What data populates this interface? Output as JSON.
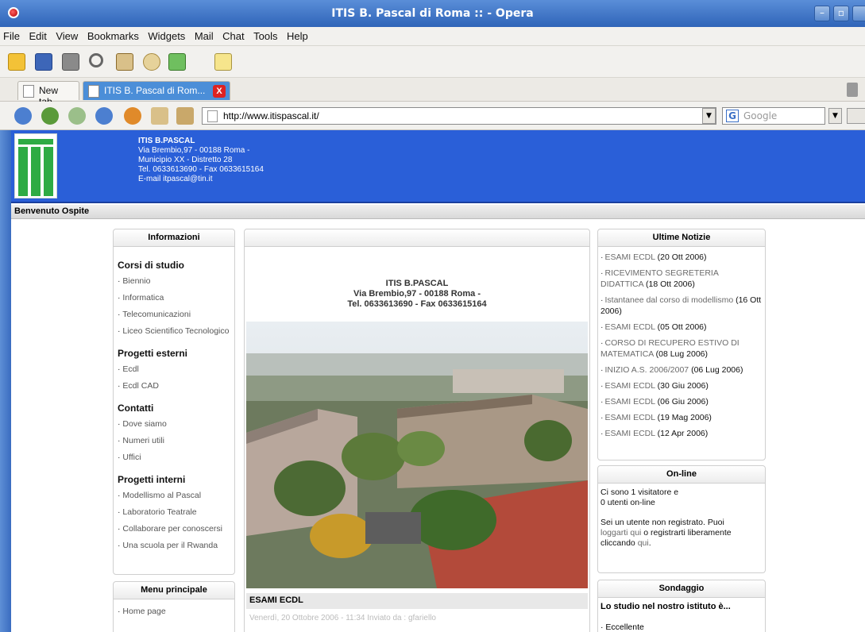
{
  "window": {
    "title": "ITIS B. Pascal di Roma :: - Opera",
    "minimize": "–",
    "maximize": "▫"
  },
  "menu": [
    "File",
    "Edit",
    "View",
    "Bookmarks",
    "Widgets",
    "Mail",
    "Chat",
    "Tools",
    "Help"
  ],
  "tabs": [
    {
      "label": "New tab",
      "active": false
    },
    {
      "label": "ITIS B. Pascal di Rom...",
      "active": true,
      "close": "X"
    }
  ],
  "address": {
    "url": "http://www.itispascal.it/",
    "search_placeholder": "Google",
    "search_icon_letter": "G"
  },
  "header": {
    "name": "ITIS B.PASCAL",
    "address": "Via Brembio,97 - 00188 Roma -",
    "district": "Municipio XX - Distretto 28",
    "phone": "Tel. 0633613690 - Fax 0633615164",
    "email": "E-mail itpascal@tin.it"
  },
  "welcome": "Benvenuto Ospite",
  "left_box": {
    "title": "Informazioni",
    "sections": [
      {
        "title": "Corsi di studio",
        "links": [
          "Biennio",
          "Informatica",
          "Telecomunicazioni",
          "Liceo Scientifico Tecnologico"
        ]
      },
      {
        "title": "Progetti esterni",
        "links": [
          "Ecdl",
          "Ecdl CAD"
        ]
      },
      {
        "title": "Contatti",
        "links": [
          "Dove siamo",
          "Numeri utili",
          "Uffici"
        ]
      },
      {
        "title": "Progetti interni",
        "links": [
          "Modellismo al Pascal",
          "Laboratorio Teatrale",
          "Collaborare per conoscersi",
          "Una scuola per il Rwanda"
        ]
      }
    ]
  },
  "menu_box": {
    "title": "Menu principale",
    "links": [
      "Home page"
    ]
  },
  "center": {
    "name": "ITIS B.PASCAL",
    "address": "Via Brembio,97 - 00188 Roma -",
    "phone": "Tel. 0633613690 - Fax 0633615164",
    "article_title": "ESAMI ECDL",
    "article_meta": "Venerdì, 20 Ottobre 2006 - 11:34 Inviato da : gfariello"
  },
  "news_box": {
    "title": "Ultime Notizie",
    "items": [
      {
        "title": "ESAMI ECDL",
        "date": "(20 Ott 2006)"
      },
      {
        "title": "RICEVIMENTO SEGRETERIA DIDATTICA",
        "date": "(18 Ott 2006)"
      },
      {
        "title": "Istantanee dal corso di modellismo",
        "date": "(16 Ott 2006)"
      },
      {
        "title": "ESAMI ECDL",
        "date": "(05 Ott 2006)"
      },
      {
        "title": "CORSO DI RECUPERO ESTIVO DI MATEMATICA",
        "date": "(08 Lug 2006)"
      },
      {
        "title": "INIZIO A.S. 2006/2007",
        "date": "(06 Lug 2006)"
      },
      {
        "title": "ESAMI ECDL",
        "date": "(30 Giu 2006)"
      },
      {
        "title": "ESAMI ECDL",
        "date": "(06 Giu 2006)"
      },
      {
        "title": "ESAMI ECDL",
        "date": "(19 Mag 2006)"
      },
      {
        "title": "ESAMI ECDL",
        "date": "(12 Apr 2006)"
      }
    ]
  },
  "online_box": {
    "title": "On-line",
    "line1": "Ci sono 1 visitatore e",
    "line2": "0 utenti on-line",
    "p1": "Sei un utente non registrato. Puoi",
    "link1": "loggarti qui",
    "p2": "o registrarti liberamente",
    "p3": "cliccando",
    "link2": "qui",
    "p4": "."
  },
  "poll_box": {
    "title": "Sondaggio",
    "question": "Lo studio nel nostro istituto è...",
    "option1": "· Eccellente"
  },
  "colors": {
    "header_blue": "#2a5fd8",
    "logo_green": "#2eab44"
  }
}
